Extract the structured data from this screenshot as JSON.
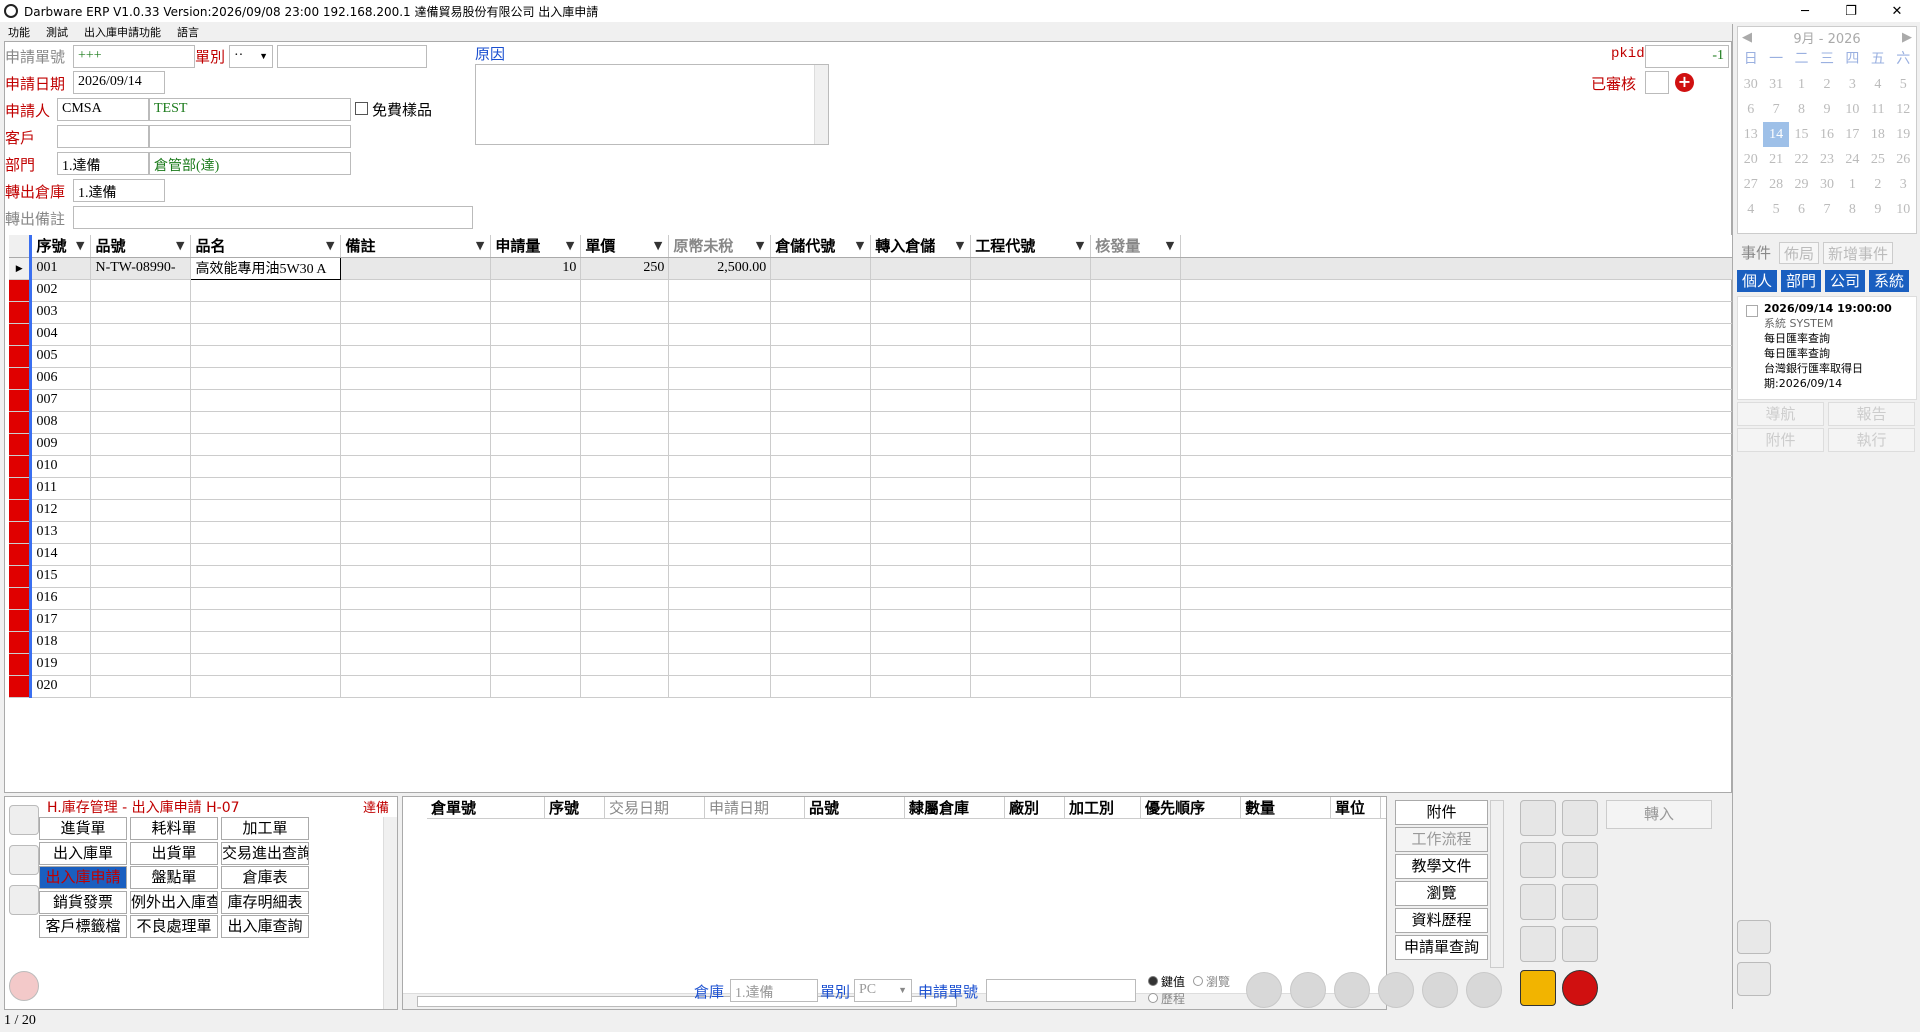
{
  "window": {
    "title": "Darbware ERP V1.0.33 Version:2026/09/08 23:00   192.168.200.1 達備貿易股份有限公司 出入庫申請",
    "minimize": "─",
    "maximize": "❐",
    "close": "✕"
  },
  "menu": [
    "功能",
    "測試",
    "出入庫申請功能",
    "語言"
  ],
  "form": {
    "req_no_label": "申請單號",
    "req_no": "+++",
    "type_label": "單別",
    "type_value": "··",
    "req_date_label": "申請日期",
    "req_date": "2026/09/14",
    "applicant_label": "申請人",
    "applicant_code": "CMSA",
    "applicant_name": "TEST",
    "free_sample_label": "免費樣品",
    "customer_label": "客戶",
    "dept_label": "部門",
    "dept_code": "1.達備",
    "dept_name": "倉管部(達)",
    "out_wh_label": "轉出倉庫",
    "out_wh": "1.達備",
    "out_note_label": "轉出備註",
    "reason_label": "原因",
    "pkid_label": "pkid",
    "pkid": "-1",
    "reviewed_label": "已審核",
    "add_icon": "+"
  },
  "grid": {
    "columns": [
      "序號",
      "品號",
      "品名",
      "備註",
      "申請量",
      "單價",
      "原幣未稅",
      "倉儲代號",
      "轉入倉儲",
      "工程代號",
      "核發量"
    ],
    "rows": [
      [
        "001",
        "N-TW-08990-",
        "高效能專用油5W30 A",
        "",
        "10",
        "250",
        "2,500.00",
        "",
        "",
        "",
        ""
      ],
      [
        "002",
        "",
        "",
        "",
        "",
        "",
        "",
        "",
        "",
        "",
        ""
      ],
      [
        "003",
        "",
        "",
        "",
        "",
        "",
        "",
        "",
        "",
        "",
        ""
      ],
      [
        "004",
        "",
        "",
        "",
        "",
        "",
        "",
        "",
        "",
        "",
        ""
      ],
      [
        "005",
        "",
        "",
        "",
        "",
        "",
        "",
        "",
        "",
        "",
        ""
      ],
      [
        "006",
        "",
        "",
        "",
        "",
        "",
        "",
        "",
        "",
        "",
        ""
      ],
      [
        "007",
        "",
        "",
        "",
        "",
        "",
        "",
        "",
        "",
        "",
        ""
      ],
      [
        "008",
        "",
        "",
        "",
        "",
        "",
        "",
        "",
        "",
        "",
        ""
      ],
      [
        "009",
        "",
        "",
        "",
        "",
        "",
        "",
        "",
        "",
        "",
        ""
      ],
      [
        "010",
        "",
        "",
        "",
        "",
        "",
        "",
        "",
        "",
        "",
        ""
      ],
      [
        "011",
        "",
        "",
        "",
        "",
        "",
        "",
        "",
        "",
        "",
        ""
      ],
      [
        "012",
        "",
        "",
        "",
        "",
        "",
        "",
        "",
        "",
        "",
        ""
      ],
      [
        "013",
        "",
        "",
        "",
        "",
        "",
        "",
        "",
        "",
        "",
        ""
      ],
      [
        "014",
        "",
        "",
        "",
        "",
        "",
        "",
        "",
        "",
        "",
        ""
      ],
      [
        "015",
        "",
        "",
        "",
        "",
        "",
        "",
        "",
        "",
        "",
        ""
      ],
      [
        "016",
        "",
        "",
        "",
        "",
        "",
        "",
        "",
        "",
        "",
        ""
      ],
      [
        "017",
        "",
        "",
        "",
        "",
        "",
        "",
        "",
        "",
        "",
        ""
      ],
      [
        "018",
        "",
        "",
        "",
        "",
        "",
        "",
        "",
        "",
        "",
        ""
      ],
      [
        "019",
        "",
        "",
        "",
        "",
        "",
        "",
        "",
        "",
        "",
        ""
      ],
      [
        "020",
        "",
        "",
        "",
        "",
        "",
        "",
        "",
        "",
        "",
        ""
      ]
    ],
    "row_pointer": "▶"
  },
  "nav": {
    "title": "H.庫存管理 - 出入庫申請  H-07",
    "company": "達備",
    "buttons": [
      "進貨單",
      "耗料單",
      "加工單",
      "出入庫單",
      "出貨單",
      "交易進出查詢",
      "出入庫申請",
      "盤點單",
      "倉庫表",
      "銷貨發票",
      "例外出入庫查詢",
      "庫存明細表",
      "客戶標籤檔",
      "不良處理單",
      "出入庫查詢"
    ]
  },
  "stock": {
    "columns": [
      "倉單號",
      "序號",
      "交易日期",
      "申請日期",
      "品號",
      "隸屬倉庫",
      "廠別",
      "加工別",
      "優先順序",
      "數量",
      "單位"
    ]
  },
  "side_buttons": [
    "附件",
    "工作流程",
    "教學文件",
    "瀏覽",
    "資料歷程",
    "申請單查詢"
  ],
  "transfer_label": "轉入",
  "filter": {
    "wh_label": "倉庫",
    "wh_value": "1.達備",
    "type_label": "單別",
    "type_value": "PC",
    "reqno_label": "申請單號",
    "mode_keyvalue": "鍵值",
    "mode_browse": "瀏覽",
    "mode_history": "歷程"
  },
  "status": {
    "record": "1  /  20"
  },
  "calendar": {
    "month": "9月",
    "year": "2026",
    "dow": [
      "日",
      "一",
      "二",
      "三",
      "四",
      "五",
      "六"
    ],
    "weeks": [
      [
        "30",
        "31",
        "1",
        "2",
        "3",
        "4",
        "5"
      ],
      [
        "6",
        "7",
        "8",
        "9",
        "10",
        "11",
        "12"
      ],
      [
        "13",
        "14",
        "15",
        "16",
        "17",
        "18",
        "19"
      ],
      [
        "20",
        "21",
        "22",
        "23",
        "24",
        "25",
        "26"
      ],
      [
        "27",
        "28",
        "29",
        "30",
        "1",
        "2",
        "3"
      ],
      [
        "4",
        "5",
        "6",
        "7",
        "8",
        "9",
        "10"
      ]
    ],
    "today": "14"
  },
  "events": {
    "label": "事件",
    "layout": "佈局",
    "add": "新增事件",
    "cats": [
      "個人",
      "部門",
      "公司",
      "系統"
    ],
    "item_time": "2026/09/14 19:00:00",
    "item_src": "系統  SYSTEM",
    "item_title": "每日匯率查詢",
    "item_body1": "每日匯率查詢",
    "item_body2": "台灣銀行匯率取得日",
    "item_body3": "期:2026/09/14",
    "actions": [
      "導航",
      "報告",
      "附件",
      "執行"
    ]
  },
  "colors": {
    "required_label": "#c00000",
    "mark": "#e00000",
    "active_tab": "#1a5fc0",
    "link": "#1a4fd0"
  }
}
